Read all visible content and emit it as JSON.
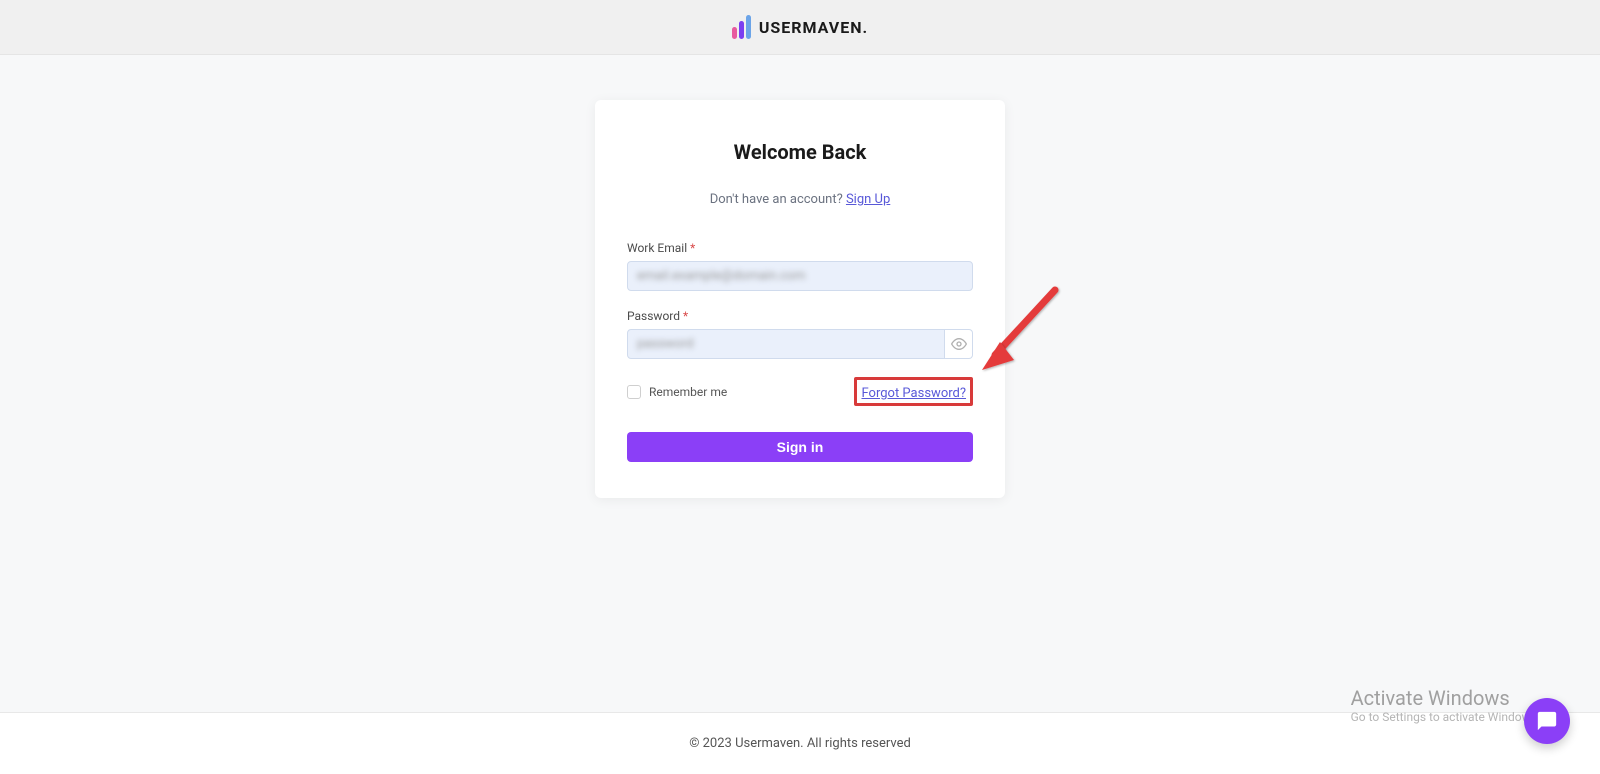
{
  "header": {
    "brand_text": "USERMAVEN."
  },
  "card": {
    "title": "Welcome Back",
    "signup_prompt": "Don't have an account? ",
    "signup_link": "Sign Up",
    "email_label": "Work Email ",
    "password_label": "Password ",
    "asterisk": "*",
    "email_blurred": "email.example@domain.com",
    "password_blurred": "password",
    "remember_label": "Remember me",
    "forgot_link": "Forgot Password?",
    "signin_button": "Sign in"
  },
  "footer": {
    "copyright": "© 2023 Usermaven. All rights reserved"
  },
  "watermark": {
    "title": "Activate Windows",
    "subtitle": "Go to Settings to activate Windows."
  },
  "colors": {
    "accent": "#8b3ff7",
    "link": "#5858d8",
    "highlight_border": "#d83a3a"
  }
}
